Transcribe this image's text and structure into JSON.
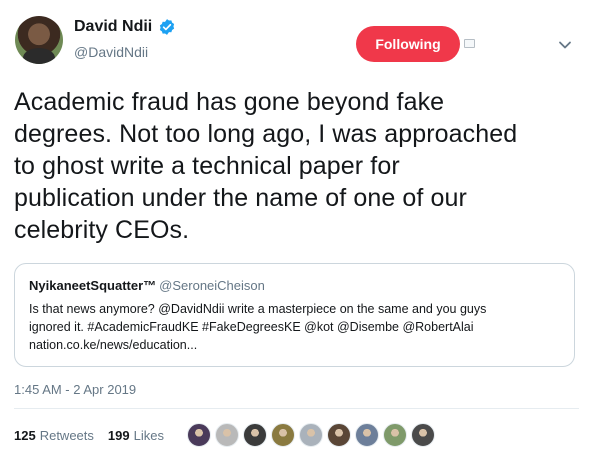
{
  "author": {
    "name": "David Ndii",
    "handle": "@DavidNdii",
    "verified_icon": "verified-badge-icon",
    "avatar_icon": "profile-photo"
  },
  "follow_button": {
    "label": "Following",
    "color": "#f0384a"
  },
  "tweet": {
    "text_lines": [
      "Academic fraud has gone beyond fake",
      "degrees. Not too long ago, I was approached",
      "to ghost write a technical paper for",
      "publication under the name of one of our",
      "celebrity CEOs."
    ]
  },
  "quote": {
    "name": "NyikaneetSquatter™",
    "handle": "@SeroneiCheison",
    "lines": [
      "Is that news anymore? @DavidNdii write a masterpiece on the same and you guys",
      "ignored it. #AcademicFraudKE #FakeDegreesKE @kot @Disembe @RobertAlai",
      "nation.co.ke/news/education..."
    ]
  },
  "timestamp": "1:45 AM - 2 Apr 2019",
  "stats": {
    "retweets_count": "125",
    "retweets_label": "Retweets",
    "likes_count": "199",
    "likes_label": "Likes"
  },
  "likers": [
    {
      "color": "#4a3a5a"
    },
    {
      "color": "#b9b9b9"
    },
    {
      "color": "#3b3b3b"
    },
    {
      "color": "#8a7a40"
    },
    {
      "color": "#aab2bb"
    },
    {
      "color": "#5a4636"
    },
    {
      "color": "#6d7f9a"
    },
    {
      "color": "#7f9a6a"
    },
    {
      "color": "#4a4a4a"
    }
  ]
}
